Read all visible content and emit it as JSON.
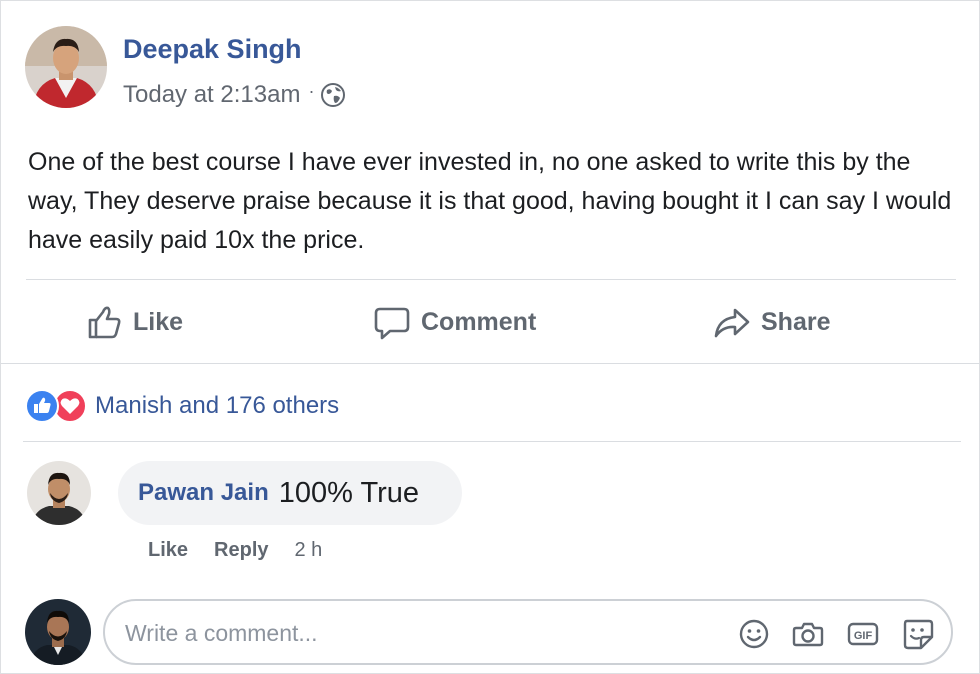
{
  "post": {
    "author": "Deepak Singh",
    "timestamp": "Today at 2:13am",
    "separator": "·",
    "privacy_icon": "globe-icon",
    "text": "One of the best course I have ever invested in, no one asked to write this by the way, They deserve praise because it is that good, having bought it I can say I would have easily paid 10x the price."
  },
  "actions": {
    "like": "Like",
    "comment": "Comment",
    "share": "Share"
  },
  "reactions": {
    "summary": "Manish and 176 others",
    "icons": [
      "like-reaction-icon",
      "love-reaction-icon"
    ]
  },
  "comment": {
    "author": "Pawan Jain",
    "text": "100% True",
    "like_label": "Like",
    "reply_label": "Reply",
    "time": "2 h"
  },
  "composer": {
    "placeholder": "Write a comment...",
    "icons": [
      "smiley-icon",
      "camera-icon",
      "gif-icon",
      "sticker-icon"
    ]
  },
  "colors": {
    "link_blue": "#385898",
    "meta_grey": "#616770",
    "like_blue": "#3b82f0",
    "love_red": "#f0405a"
  }
}
